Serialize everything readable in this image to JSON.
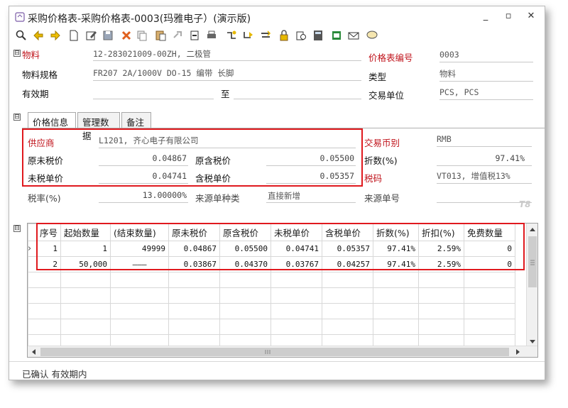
{
  "window": {
    "title": "采购价格表-采购价格表-0003(玛雅电子）(演示版)",
    "minimize": "_",
    "maximize": "▫",
    "close": "✕"
  },
  "toolbar_icons": [
    "magnify-icon",
    "arrow-left-icon",
    "arrow-right-icon",
    "new-doc-icon",
    "edit-icon",
    "save-icon",
    "delete-icon",
    "copy-icon",
    "paste-icon",
    "link-icon",
    "import-icon",
    "print-icon",
    "flow-a-icon",
    "flow-b-icon",
    "flow-c-icon",
    "lock-icon",
    "audit-icon",
    "calc-icon",
    "excel-icon",
    "mail-icon",
    "chat-icon"
  ],
  "header": {
    "material_label": "物料",
    "material_value": "12-283021009-00ZH, 二极管",
    "spec_label": "物料规格",
    "spec_value": "FR207 2A/1000V DO-15 编带 长脚",
    "validity_label": "有效期",
    "validity_to": "至",
    "price_no_label": "价格表编号",
    "price_no_value": "0003",
    "type_label": "类型",
    "type_value": "物料",
    "unit_label": "交易单位",
    "unit_value": "PCS, PCS",
    "expander": "⊟"
  },
  "tabs": [
    "价格信息",
    "管理数据",
    "备注"
  ],
  "price_info": {
    "supplier_label": "供应商",
    "supplier_value": "L1201, 齐心电子有限公司",
    "orig_untax_label": "原未税价",
    "orig_untax_value": "0.04867",
    "orig_tax_label": "原含税价",
    "orig_tax_value": "0.05500",
    "untax_unit_label": "未税单价",
    "untax_unit_value": "0.04741",
    "tax_unit_label": "含税单价",
    "tax_unit_value": "0.05357",
    "currency_label": "交易币别",
    "currency_value": "RMB",
    "discount_label": "折数(%)",
    "discount_value": "97.41%",
    "taxcode_label": "税码",
    "taxcode_value": "VT013, 增值税13%",
    "taxrate_label": "税率(%)",
    "taxrate_value": "13.00000%",
    "source_type_label": "来源单种类",
    "source_type_value": "直接新增",
    "source_no_label": "来源单号",
    "watermark": "T8"
  },
  "grid": {
    "columns": [
      "序号",
      "起始数量",
      "(结束数量)",
      "原未税价",
      "原含税价",
      "未税单价",
      "含税单价",
      "折数(%)",
      "折扣(%)",
      "免费数量"
    ],
    "rows": [
      [
        "1",
        "1",
        "49999",
        "0.04867",
        "0.05500",
        "0.04741",
        "0.05357",
        "97.41%",
        "2.59%",
        "0"
      ],
      [
        "2",
        "50,000",
        "———",
        "0.03867",
        "0.04370",
        "0.03767",
        "0.04257",
        "97.41%",
        "2.59%",
        "0"
      ]
    ],
    "row_marker": "›"
  },
  "status": {
    "text": "已确认 有效期内"
  },
  "colors": {
    "highlight_red": "#e0191e",
    "label_red": "#c0141c"
  }
}
